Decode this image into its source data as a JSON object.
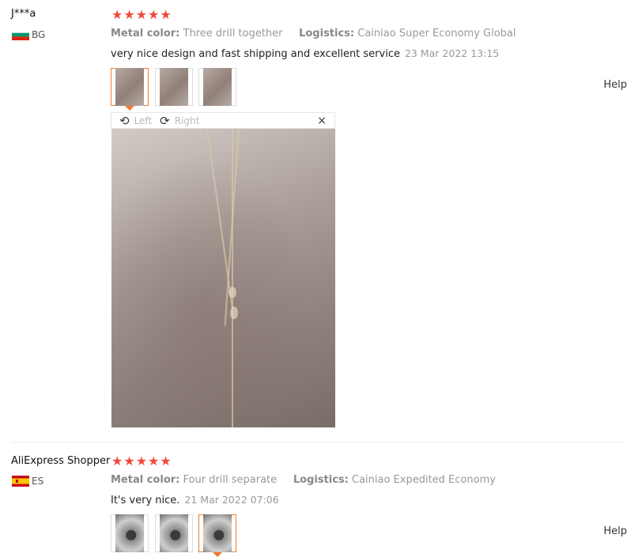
{
  "reviews": [
    {
      "user": "J***a",
      "country": "BG",
      "stars": "★★★★★",
      "metal_label": "Metal color:",
      "metal_value": "Three drill together",
      "logistics_label": "Logistics:",
      "logistics_value": "Cainiao Super Economy Global",
      "text": "very nice design and fast shipping and excellent service",
      "date": "23 Mar 2022 13:15"
    },
    {
      "user": "AliExpress Shopper",
      "country": "ES",
      "stars": "★★★★★",
      "metal_label": "Metal color:",
      "metal_value": "Four drill separate",
      "logistics_label": "Logistics:",
      "logistics_value": "Cainiao Expedited Economy",
      "text": "It's very nice.",
      "date": "21 Mar 2022 07:06"
    }
  ],
  "viewer": {
    "rotate_left": "Left",
    "rotate_right": "Right",
    "close": "×"
  },
  "help_label": "Help",
  "icons": {
    "rotate_left": "rotate-left-icon",
    "rotate_right": "rotate-right-icon",
    "close": "close-icon"
  },
  "colors": {
    "stars": "#f04a3a",
    "active_thumb": "#f07c2a"
  }
}
